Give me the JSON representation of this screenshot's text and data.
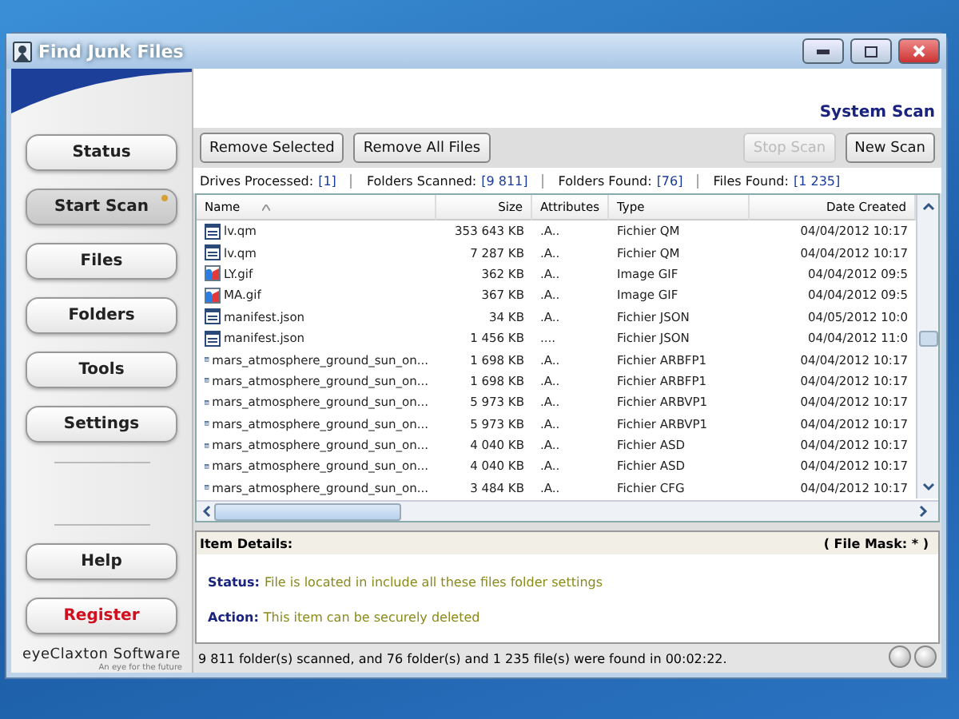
{
  "window": {
    "title": "Find Junk Files"
  },
  "sidebar": {
    "items": [
      {
        "label": "Status",
        "selected": false
      },
      {
        "label": "Start Scan",
        "selected": true
      },
      {
        "label": "Files",
        "selected": false
      },
      {
        "label": "Folders",
        "selected": false
      },
      {
        "label": "Tools",
        "selected": false
      },
      {
        "label": "Settings",
        "selected": false
      }
    ],
    "bottom_items": [
      {
        "label": "Help",
        "kind": "nav"
      },
      {
        "label": "Register",
        "kind": "alert"
      }
    ],
    "brand": "eyeClaxton Software",
    "tagline": "An eye for the future"
  },
  "header": {
    "title": "System Scan"
  },
  "toolbar": {
    "left": [
      {
        "label": "Remove Selected",
        "disabled": false
      },
      {
        "label": "Remove All Files",
        "disabled": false
      }
    ],
    "right": [
      {
        "label": "Stop Scan",
        "disabled": true
      },
      {
        "label": "New Scan",
        "disabled": false
      }
    ]
  },
  "stats": [
    {
      "label": "Drives Processed:",
      "value": "[1]"
    },
    {
      "label": "Folders Scanned:",
      "value": "[9 811]"
    },
    {
      "label": "Folders Found:",
      "value": "[76]"
    },
    {
      "label": "Files Found:",
      "value": "[1 235]"
    }
  ],
  "table": {
    "columns": [
      "Name",
      "Size",
      "Attributes",
      "Type",
      "Date Created"
    ],
    "rows": [
      {
        "kind": "doc",
        "cells": [
          "lv.qm",
          "353 643 KB",
          ".A..",
          "Fichier QM",
          "04/04/2012 10:17"
        ]
      },
      {
        "kind": "doc",
        "cells": [
          "lv.qm",
          "7 287 KB",
          ".A..",
          "Fichier QM",
          "04/04/2012 10:17"
        ]
      },
      {
        "kind": "image",
        "cells": [
          "LY.gif",
          "362 KB",
          ".A..",
          "Image GIF",
          "04/04/2012 09:5"
        ]
      },
      {
        "kind": "image",
        "cells": [
          "MA.gif",
          "367 KB",
          ".A..",
          "Image GIF",
          "04/04/2012 09:5"
        ]
      },
      {
        "kind": "doc",
        "cells": [
          "manifest.json",
          "34 KB",
          ".A..",
          "Fichier JSON",
          "04/05/2012 10:0"
        ]
      },
      {
        "kind": "doc",
        "cells": [
          "manifest.json",
          "1 456 KB",
          "....",
          "Fichier JSON",
          "04/04/2012 11:0"
        ]
      },
      {
        "kind": "doc",
        "cells": [
          "mars_atmosphere_ground_sun_on...",
          "1 698 KB",
          ".A..",
          "Fichier ARBFP1",
          "04/04/2012 10:17"
        ]
      },
      {
        "kind": "doc",
        "cells": [
          "mars_atmosphere_ground_sun_on...",
          "1 698 KB",
          ".A..",
          "Fichier ARBFP1",
          "04/04/2012 10:17"
        ]
      },
      {
        "kind": "doc",
        "cells": [
          "mars_atmosphere_ground_sun_on...",
          "5 973 KB",
          ".A..",
          "Fichier ARBVP1",
          "04/04/2012 10:17"
        ]
      },
      {
        "kind": "doc",
        "cells": [
          "mars_atmosphere_ground_sun_on...",
          "5 973 KB",
          ".A..",
          "Fichier ARBVP1",
          "04/04/2012 10:17"
        ]
      },
      {
        "kind": "doc",
        "cells": [
          "mars_atmosphere_ground_sun_on...",
          "4 040 KB",
          ".A..",
          "Fichier ASD",
          "04/04/2012 10:17"
        ]
      },
      {
        "kind": "doc",
        "cells": [
          "mars_atmosphere_ground_sun_on...",
          "4 040 KB",
          ".A..",
          "Fichier ASD",
          "04/04/2012 10:17"
        ]
      },
      {
        "kind": "doc",
        "cells": [
          "mars_atmosphere_ground_sun_on...",
          "3 484 KB",
          ".A..",
          "Fichier CFG",
          "04/04/2012 10:17"
        ]
      }
    ]
  },
  "details": {
    "title": "Item Details:",
    "mask": "( File Mask:  * )",
    "lines": [
      {
        "label": "Status:",
        "text": "File is located in include all these files folder settings"
      },
      {
        "label": "Action:",
        "text": "This item can be securely deleted"
      }
    ]
  },
  "status_bar": {
    "text": "9 811 folder(s) scanned, and 76 folder(s) and 1 235 file(s) were found in 00:02:22."
  }
}
